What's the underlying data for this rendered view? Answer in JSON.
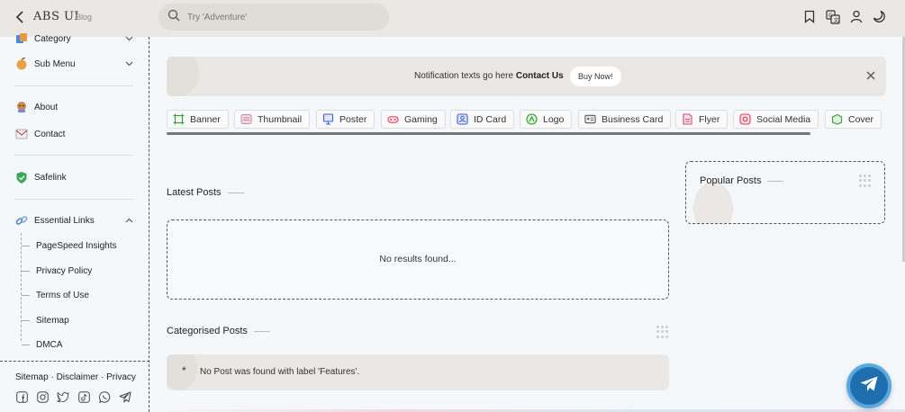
{
  "header": {
    "brand": "ABS UI",
    "brand_sub": "Blog",
    "search_placeholder": "Try 'Adventure'",
    "icons": [
      "bookmark-icon",
      "translate-icon",
      "user-icon",
      "dark-mode-icon"
    ]
  },
  "sidebar": {
    "items": [
      {
        "label": "Category",
        "icon": "category-icon"
      },
      {
        "label": "Sub Menu",
        "icon": "submenu-icon"
      },
      {
        "label": "About",
        "icon": "about-icon"
      },
      {
        "label": "Contact",
        "icon": "contact-icon"
      },
      {
        "label": "Safelink",
        "icon": "shield-icon"
      },
      {
        "label": "Essential Links",
        "icon": "link-icon"
      }
    ],
    "sub_items": [
      "PageSpeed Insights",
      "Privacy Policy",
      "Terms of Use",
      "Sitemap",
      "DMCA"
    ],
    "footer_links": [
      "Sitemap",
      "Disclaimer",
      "Privacy"
    ],
    "footer_separator": " · ",
    "social_icons": [
      "facebook-icon",
      "instagram-icon",
      "twitter-icon",
      "tiktok-icon",
      "whatsapp-icon",
      "telegram-icon"
    ]
  },
  "notification": {
    "text": "Notification texts go here",
    "link": "Contact Us",
    "button": "Buy Now!"
  },
  "categories": [
    {
      "label": "Banner",
      "icon": "banner-icon",
      "color": "#3a9a3a"
    },
    {
      "label": "Thumbnail",
      "icon": "thumbnail-icon",
      "color": "#c48aa0"
    },
    {
      "label": "Poster",
      "icon": "poster-icon",
      "color": "#3b5bd6"
    },
    {
      "label": "Gaming",
      "icon": "gaming-icon",
      "color": "#e03b5a"
    },
    {
      "label": "ID Card",
      "icon": "id-card-icon",
      "color": "#3b5bd6"
    },
    {
      "label": "Logo",
      "icon": "logo-icon",
      "color": "#2a9a2a"
    },
    {
      "label": "Business Card",
      "icon": "business-card-icon",
      "color": "#555555"
    },
    {
      "label": "Flyer",
      "icon": "flyer-icon",
      "color": "#d04a7a"
    },
    {
      "label": "Social Media",
      "icon": "social-media-icon",
      "color": "#e03b5a"
    },
    {
      "label": "Cover",
      "icon": "cover-icon",
      "color": "#3a9a3a"
    }
  ],
  "latest_posts": {
    "title": "Latest Posts",
    "empty_text": "No results found..."
  },
  "categorised_posts": {
    "title": "Categorised Posts",
    "marker": "*",
    "empty_text": "No Post was found with label 'Features'."
  },
  "popular_posts": {
    "title": "Popular Posts"
  },
  "colors": {
    "accent": "#1f6fb0",
    "header_bg": "#ebe7e4",
    "page_bg": "#f4f8fb"
  }
}
